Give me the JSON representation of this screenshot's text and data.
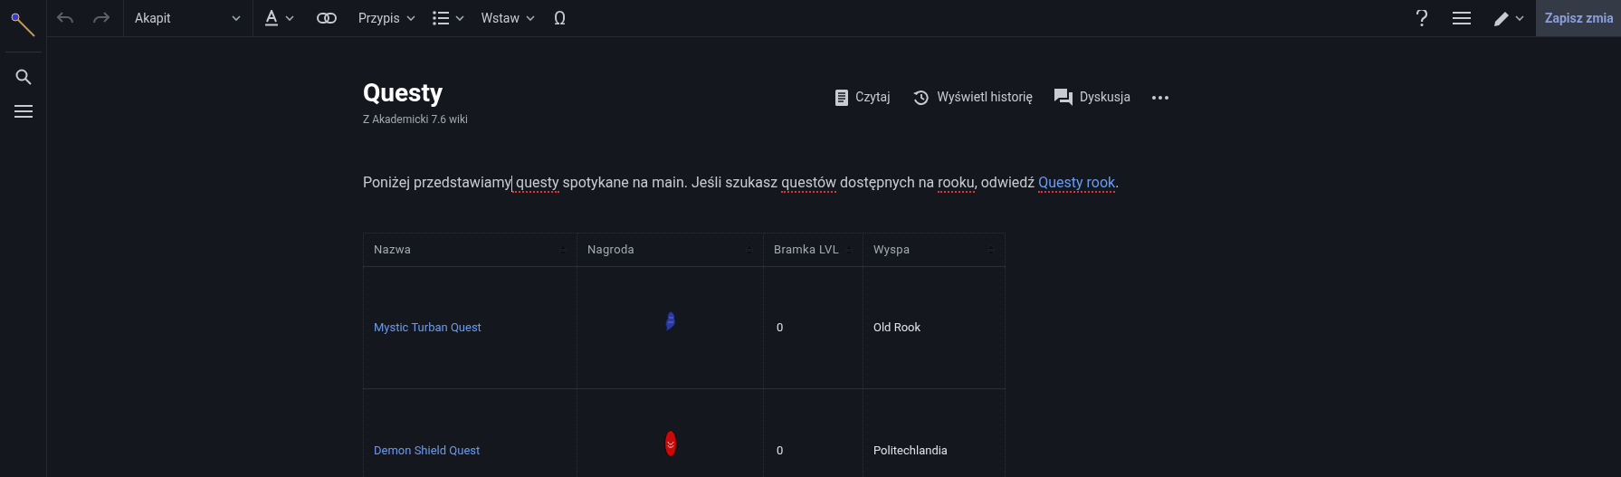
{
  "toolbar": {
    "format": "Akapit",
    "reference": "Przypis",
    "insert": "Wstaw",
    "special_char": "Ω",
    "undo_disabled": true,
    "redo_disabled": true,
    "save": "Zapisz zmia"
  },
  "page": {
    "title": "Questy",
    "subtitle": "Z Akademicki 7.6 wiki",
    "actions": [
      {
        "kind": "read",
        "label": "Czytaj"
      },
      {
        "kind": "history",
        "label": "Wyświetl historię"
      },
      {
        "kind": "talk",
        "label": "Dyskusja"
      },
      {
        "kind": "more"
      }
    ],
    "intro": [
      {
        "kind": "text",
        "text": "Poniżej przedstawiamy",
        "misspelled": false,
        "cursor_after": true
      },
      {
        "kind": "text",
        "text": " questy",
        "misspelled": true,
        "cursor_after": false
      },
      {
        "kind": "text",
        "text": " spotykane na main. Jeśli szukasz ",
        "misspelled": false,
        "cursor_after": false
      },
      {
        "kind": "text",
        "text": "questów",
        "misspelled": true,
        "cursor_after": false
      },
      {
        "kind": "text",
        "text": " dostępnych na ",
        "misspelled": false,
        "cursor_after": false
      },
      {
        "kind": "text",
        "text": "rooku",
        "misspelled": true,
        "cursor_after": false
      },
      {
        "kind": "text",
        "text": ", odwiedź ",
        "misspelled": false,
        "cursor_after": false
      },
      {
        "kind": "link",
        "text": "Questy rook",
        "misspelled": true,
        "cursor_after": false
      },
      {
        "kind": "text",
        "text": ".",
        "misspelled": false,
        "cursor_after": false
      }
    ]
  },
  "table": {
    "columns": [
      "Nazwa",
      "Nagroda",
      "Bramka LVL",
      "Wyspa"
    ],
    "rows": [
      {
        "name": "Mystic Turban Quest",
        "kind": "turban",
        "level": "0",
        "island": "Old Rook"
      },
      {
        "name": "Demon Shield Quest",
        "kind": "shield",
        "level": "0",
        "island": "Politechlandia"
      }
    ]
  }
}
